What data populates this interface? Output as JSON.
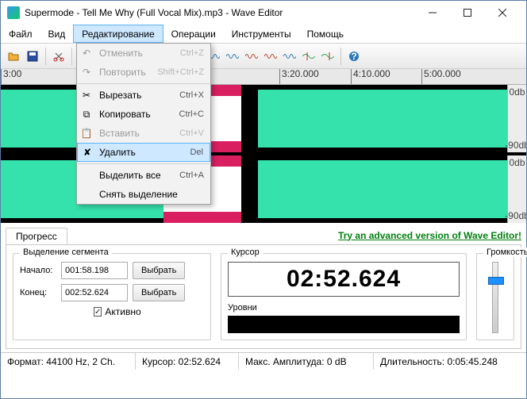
{
  "window": {
    "title": "Supermode - Tell Me Why (Full Vocal Mix).mp3 - Wave Editor"
  },
  "menu": {
    "file": "Файл",
    "view": "Вид",
    "edit": "Редактирование",
    "operations": "Операции",
    "tools": "Инструменты",
    "help": "Помощь"
  },
  "edit_menu": {
    "undo": {
      "label": "Отменить",
      "shortcut": "Ctrl+Z"
    },
    "redo": {
      "label": "Повторить",
      "shortcut": "Shift+Ctrl+Z"
    },
    "cut": {
      "label": "Вырезать",
      "shortcut": "Ctrl+X"
    },
    "copy": {
      "label": "Копировать",
      "shortcut": "Ctrl+C"
    },
    "paste": {
      "label": "Вставить",
      "shortcut": "Ctrl+V"
    },
    "delete": {
      "label": "Удалить",
      "shortcut": "Del"
    },
    "select_all": {
      "label": "Выделить все",
      "shortcut": "Ctrl+A"
    },
    "deselect": {
      "label": "Снять выделение",
      "shortcut": ""
    }
  },
  "ruler": {
    "t0": "3:00",
    "t1": "3:20.000",
    "t2": "4:10.000",
    "t3": "5:00.000"
  },
  "db": {
    "top": "0db",
    "mid": "-90db"
  },
  "tabs": {
    "progress": "Прогресс",
    "ad": "Try an advanced version of Wave Editor!"
  },
  "segment": {
    "legend": "Выделение сегмента",
    "start_label": "Начало:",
    "start_value": "001:58.198",
    "start_btn": "Выбрать",
    "end_label": "Конец:",
    "end_value": "002:52.624",
    "end_btn": "Выбрать",
    "active": "Активно"
  },
  "cursor": {
    "legend": "Курсор",
    "value": "02:52.624",
    "levels_label": "Уровни"
  },
  "volume": {
    "legend": "Громкость"
  },
  "status": {
    "format": "Формат: 44100 Hz, 2 Ch.",
    "cursor": "Курсор: 02:52.624",
    "amp": "Макс. Амплитуда: 0 dB",
    "length": "Длительность: 0:05:45.248"
  }
}
